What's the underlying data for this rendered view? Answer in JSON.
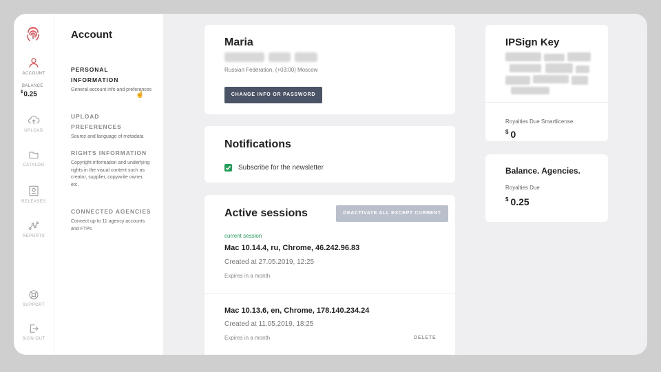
{
  "nav": {
    "logo_icon": "fingerprint-icon",
    "brand_color": "#e0454a",
    "items": [
      {
        "label": "ACCOUNT",
        "icon": "user-icon"
      },
      {
        "label": "UPLOAD",
        "icon": "cloud-upload-icon"
      },
      {
        "label": "CATALOG",
        "icon": "folder-icon"
      },
      {
        "label": "RELEASES",
        "icon": "release-icon"
      },
      {
        "label": "REPORTS",
        "icon": "graph-icon"
      },
      {
        "label": "SUPPORT",
        "icon": "lifebuoy-icon"
      },
      {
        "label": "SIGN OUT",
        "icon": "sign-out-icon"
      }
    ],
    "balance_label": "BALANCE",
    "balance_currency": "$",
    "balance_value": "0.25"
  },
  "settings": {
    "title": "Account",
    "sections": [
      {
        "title": "PERSONAL INFORMATION",
        "desc": "General account info and preferences"
      },
      {
        "title": "UPLOAD PREFERENCES",
        "desc": "Source and language of metadata"
      },
      {
        "title": "RIGHTS INFORMATION",
        "desc": "Copyright information and underlying rights in the visual content such as creator, supplier, copywrite owner, etc."
      },
      {
        "title": "CONNECTED AGENCIES",
        "desc": "Connect up to 11 agency accounts and FTPs"
      }
    ]
  },
  "profile": {
    "name": "Maria",
    "location": "Russian Federation, (+03:00) Moscow",
    "change_button": "CHANGE INFO OR PASSWORD"
  },
  "notifications": {
    "title": "Notifications",
    "newsletter_label": "Subscribe for the newsletter",
    "newsletter_checked": true
  },
  "sessions": {
    "title": "Active sessions",
    "deactivate_button": "DEACTIVATE ALL EXCEPT CURRENT",
    "current_label": "current session",
    "items": [
      {
        "title": "Mac 10.14.4, ru, Chrome, 46.242.96.83",
        "created": "Created at 27.05.2019, 12:25",
        "expires": "Expires in a month"
      },
      {
        "title": "Mac 10.13.6, en, Chrome, 178.140.234.24",
        "created": "Created at 11.05.2019, 18:25",
        "expires": "Expires in a month",
        "action": "DELETE"
      }
    ]
  },
  "ipsign": {
    "title": "IPSign Key",
    "royalties_label": "Royalties Due Smartlicense",
    "currency": "$",
    "royalties_value": "0"
  },
  "agencies": {
    "title": "Balance. Agencies.",
    "royalties_label": "Royalties Due",
    "currency": "$",
    "royalties_value": "0.25"
  },
  "colors": {
    "accent_dark": "#4b5466",
    "disabled_button": "#b9c0cc",
    "success": "#22a05a"
  }
}
